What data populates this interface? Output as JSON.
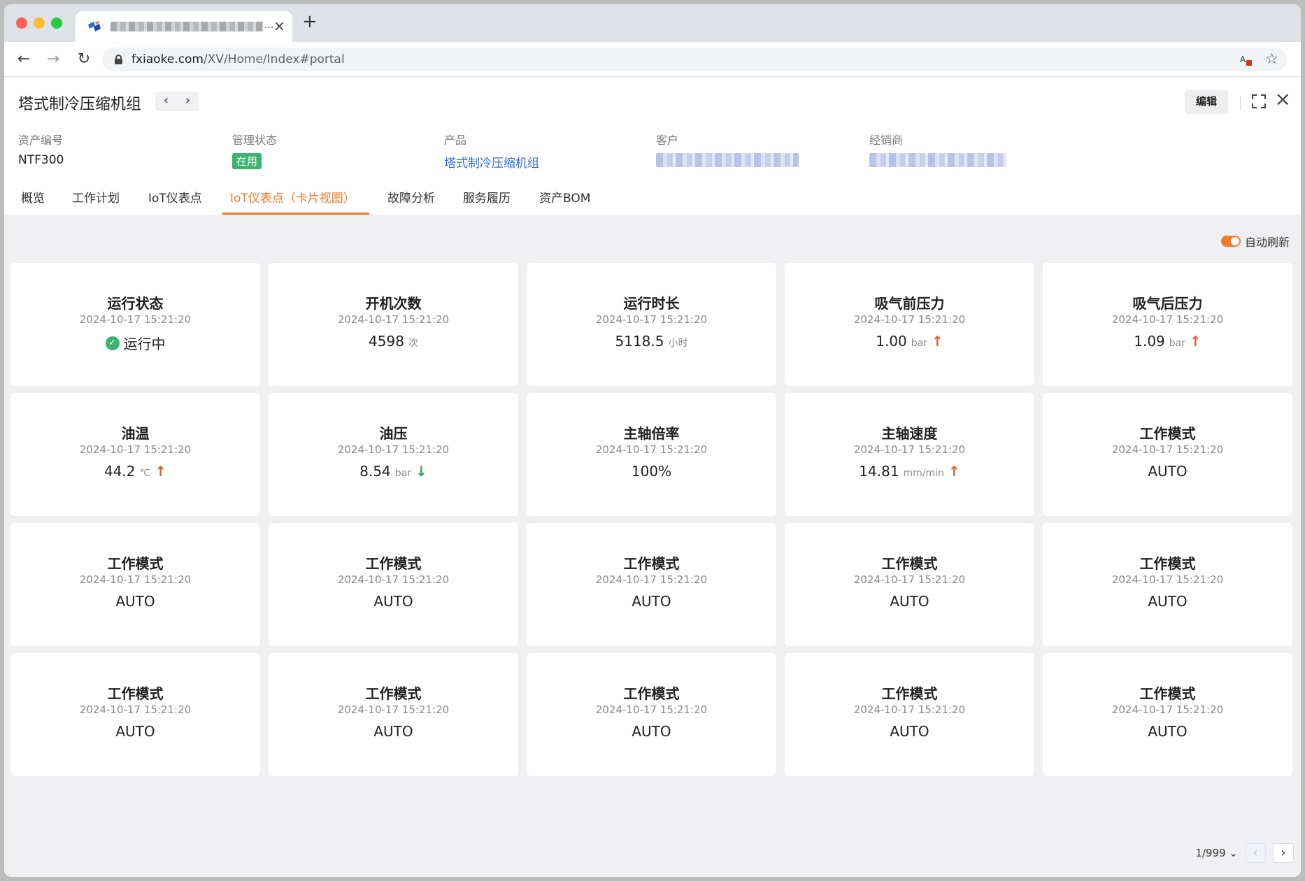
{
  "browser": {
    "tab_close": "×",
    "new_tab": "+",
    "url_host": "fxiaoke.com",
    "url_path": "/XV/Home/Index#portal"
  },
  "record": {
    "title": "塔式制冷压缩机组",
    "edit_label": "编辑",
    "fields": [
      {
        "label": "资产编号",
        "value": "NTF300"
      },
      {
        "label": "管理状态",
        "value": "在用"
      },
      {
        "label": "产品",
        "value": "塔式制冷压缩机组"
      },
      {
        "label": "客户",
        "value": ""
      },
      {
        "label": "经销商",
        "value": ""
      }
    ]
  },
  "tabs": [
    {
      "label": "概览"
    },
    {
      "label": "工作计划"
    },
    {
      "label": "IoT仪表点"
    },
    {
      "label": "IoT仪表点（卡片视图）"
    },
    {
      "label": "故障分析"
    },
    {
      "label": "服务履历"
    },
    {
      "label": "资产BOM"
    }
  ],
  "auto_refresh_label": "自动刷新",
  "cards": [
    {
      "title": "运行状态",
      "time": "2024-10-17  15:21:20",
      "value": "运行中",
      "unit": "",
      "trend": "",
      "status": "ok"
    },
    {
      "title": "开机次数",
      "time": "2024-10-17  15:21:20",
      "value": "4598",
      "unit": "次",
      "trend": ""
    },
    {
      "title": "运行时长",
      "time": "2024-10-17  15:21:20",
      "value": "5118.5",
      "unit": "小时",
      "trend": ""
    },
    {
      "title": "吸气前压力",
      "time": "2024-10-17  15:21:20",
      "value": "1.00",
      "unit": "bar",
      "trend": "up"
    },
    {
      "title": "吸气后压力",
      "time": "2024-10-17  15:21:20",
      "value": "1.09",
      "unit": "bar",
      "trend": "up"
    },
    {
      "title": "油温",
      "time": "2024-10-17  15:21:20",
      "value": "44.2",
      "unit": "℃",
      "trend": "up"
    },
    {
      "title": "油压",
      "time": "2024-10-17  15:21:20",
      "value": "8.54",
      "unit": "bar",
      "trend": "down"
    },
    {
      "title": "主轴倍率",
      "time": "2024-10-17  15:21:20",
      "value": "100%",
      "unit": "",
      "trend": ""
    },
    {
      "title": "主轴速度",
      "time": "2024-10-17  15:21:20",
      "value": "14.81",
      "unit": "mm/min",
      "trend": "up"
    },
    {
      "title": "工作模式",
      "time": "2024-10-17  15:21:20",
      "value": "AUTO",
      "unit": "",
      "trend": ""
    },
    {
      "title": "工作模式",
      "time": "2024-10-17  15:21:20",
      "value": "AUTO",
      "unit": "",
      "trend": ""
    },
    {
      "title": "工作模式",
      "time": "2024-10-17  15:21:20",
      "value": "AUTO",
      "unit": "",
      "trend": ""
    },
    {
      "title": "工作模式",
      "time": "2024-10-17  15:21:20",
      "value": "AUTO",
      "unit": "",
      "trend": ""
    },
    {
      "title": "工作模式",
      "time": "2024-10-17  15:21:20",
      "value": "AUTO",
      "unit": "",
      "trend": ""
    },
    {
      "title": "工作模式",
      "time": "2024-10-17  15:21:20",
      "value": "AUTO",
      "unit": "",
      "trend": ""
    },
    {
      "title": "工作模式",
      "time": "2024-10-17  15:21:20",
      "value": "AUTO",
      "unit": "",
      "trend": ""
    },
    {
      "title": "工作模式",
      "time": "2024-10-17  15:21:20",
      "value": "AUTO",
      "unit": "",
      "trend": ""
    },
    {
      "title": "工作模式",
      "time": "2024-10-17  15:21:20",
      "value": "AUTO",
      "unit": "",
      "trend": ""
    },
    {
      "title": "工作模式",
      "time": "2024-10-17  15:21:20",
      "value": "AUTO",
      "unit": "",
      "trend": ""
    },
    {
      "title": "工作模式",
      "time": "2024-10-17  15:21:20",
      "value": "AUTO",
      "unit": "",
      "trend": ""
    }
  ],
  "pagination": {
    "indicator": "1/999"
  },
  "colors": {
    "accent": "#f07a2a",
    "status_green": "#3bb46e",
    "trend_up": "#e25a35",
    "trend_down": "#2e9d5a",
    "link": "#2f6fde"
  }
}
